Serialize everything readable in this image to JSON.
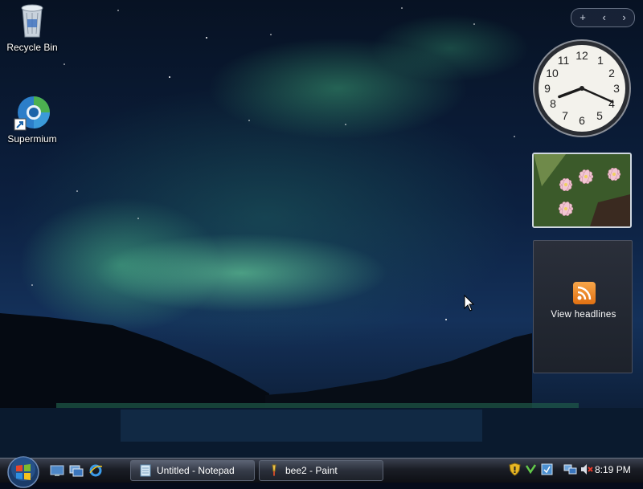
{
  "desktop": {
    "icons": [
      {
        "label": "Recycle Bin",
        "icon": "recycle-bin-icon"
      },
      {
        "label": "Supermium",
        "icon": "supermium-browser-icon"
      }
    ]
  },
  "sidebar": {
    "controls": {
      "add": "+",
      "prev": "‹",
      "next": "›"
    },
    "clock": {
      "numbers": [
        "12",
        "1",
        "2",
        "3",
        "4",
        "5",
        "6",
        "7",
        "8",
        "9",
        "10",
        "11"
      ],
      "time": "8:19"
    },
    "feed": {
      "label": "View headlines",
      "icon": "rss-icon"
    }
  },
  "taskbar": {
    "start": {
      "icon": "windows-start-orb-icon"
    },
    "quick_launch": [
      "show-desktop-icon",
      "switch-windows-icon",
      "internet-explorer-icon"
    ],
    "tasks": [
      {
        "label": "Untitled - Notepad",
        "icon": "notepad-icon",
        "active": true
      },
      {
        "label": "bee2 - Paint",
        "icon": "paint-icon",
        "active": false
      }
    ],
    "tray_icons": [
      "security-shield-icon",
      "network-icon",
      "windows-update-icon",
      "network-connection-icon",
      "volume-muted-icon"
    ],
    "clock": "8:19 PM"
  },
  "colors": {
    "aurora": "#5fe0a0",
    "taskbar": "#1a1d25",
    "rss": "#f08a24"
  }
}
